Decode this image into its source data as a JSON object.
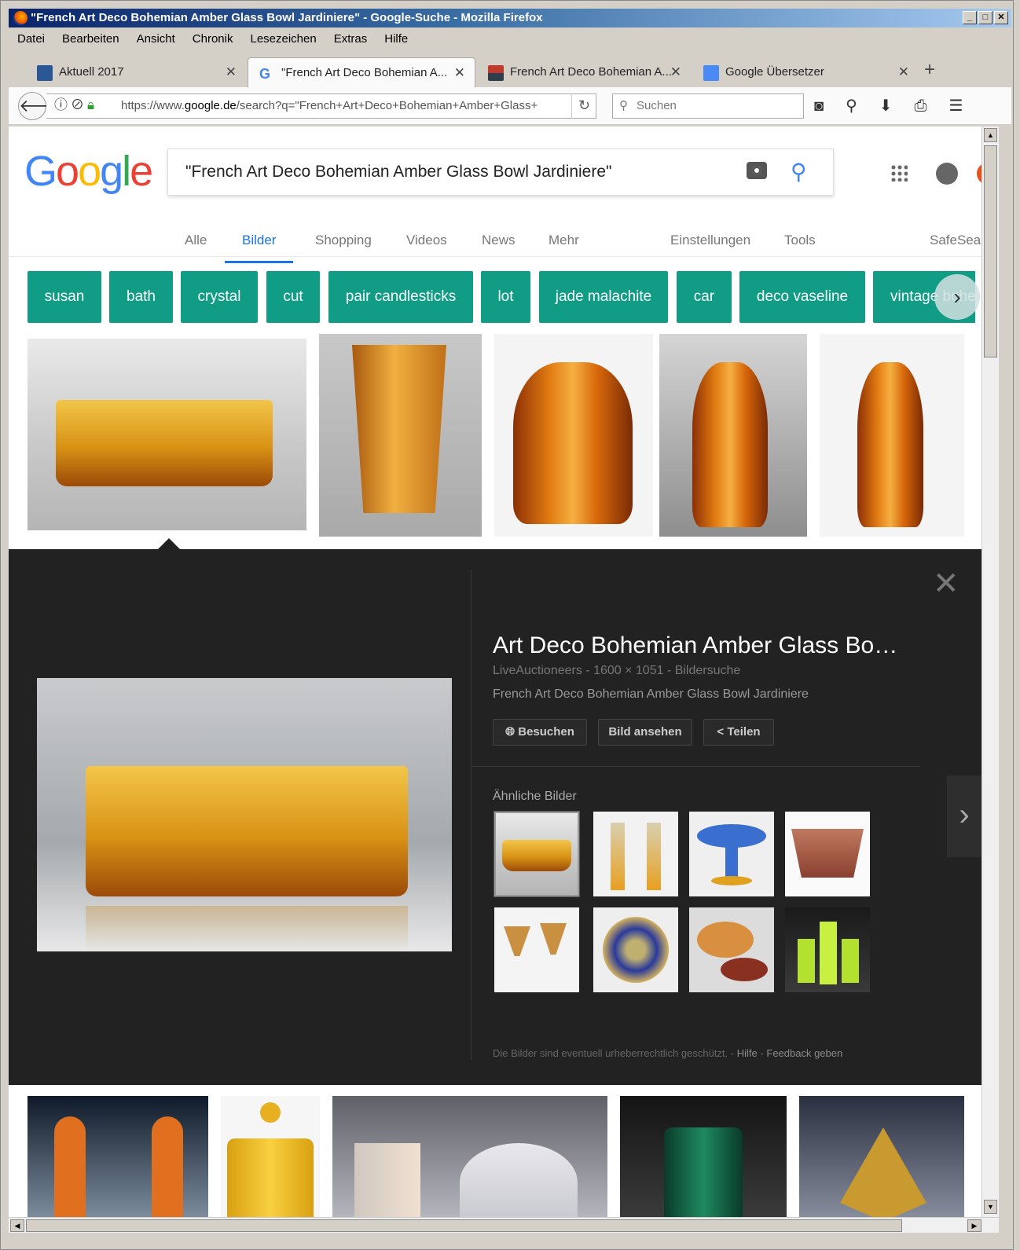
{
  "window": {
    "title": "\"French Art Deco Bohemian Amber Glass Bowl Jardiniere\" - Google-Suche - Mozilla Firefox"
  },
  "menu": [
    "Datei",
    "Bearbeiten",
    "Ansicht",
    "Chronik",
    "Lesezeichen",
    "Extras",
    "Hilfe"
  ],
  "tabs": [
    {
      "label": "Aktuell 2017",
      "close": "✕"
    },
    {
      "label": "\"French Art Deco Bohemian A...",
      "close": "✕"
    },
    {
      "label": "French Art Deco Bohemian A...",
      "close": "✕"
    },
    {
      "label": "Google Übersetzer",
      "close": "✕"
    }
  ],
  "newtab": "+",
  "nav": {
    "url_prefix": "https://www.",
    "url_domain": "google.de",
    "url_rest": "/search?q=\"French+Art+Deco+Bohemian+Amber+Glass+",
    "search_placeholder": "Suchen"
  },
  "google": {
    "query": "\"French Art Deco Bohemian Amber Glass Bowl Jardiniere\"",
    "tabs": [
      "Alle",
      "Bilder",
      "Shopping",
      "Videos",
      "News",
      "Mehr",
      "Einstellungen",
      "Tools",
      "SafeSea"
    ],
    "chips": [
      "susan",
      "bath",
      "crystal",
      "cut",
      "pair candlesticks",
      "lot",
      "jade malachite",
      "car",
      "deco vaseline",
      "vintage bohe"
    ]
  },
  "preview": {
    "title": "Art Deco Bohemian Amber Glass Bo…",
    "meta": "LiveAuctioneers - 1600 × 1051 - Bildersuche",
    "description": "French Art Deco Bohemian Amber Glass Bowl Jardiniere",
    "buttons": {
      "visit": "Besuchen",
      "view": "Bild ansehen",
      "share": "Teilen"
    },
    "similar_label": "Ähnliche Bilder",
    "footer_text": "Die Bilder sind eventuell urheberrechtlich geschützt.",
    "footer_sep": "-",
    "footer_help": "Hilfe",
    "footer_feedback": "Feedback geben"
  },
  "colors": {
    "chip": "#109c85",
    "google_blue": "#1a73e8",
    "panel": "#222222"
  }
}
